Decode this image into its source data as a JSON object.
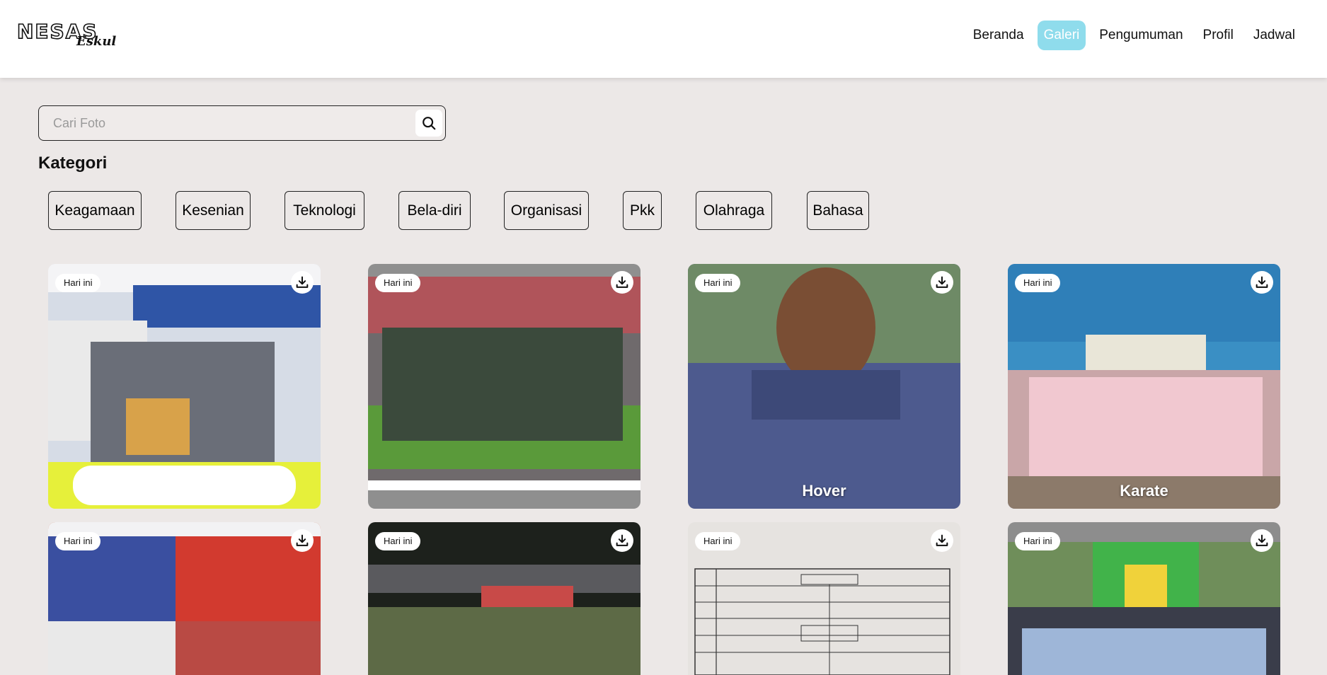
{
  "header": {
    "logo_text": "NESAS",
    "logo_subtext": "Eskul",
    "nav": [
      {
        "label": "Beranda",
        "active": false
      },
      {
        "label": "Galeri",
        "active": true
      },
      {
        "label": "Pengumuman",
        "active": false
      },
      {
        "label": "Profil",
        "active": false
      },
      {
        "label": "Jadwal",
        "active": false
      }
    ],
    "active_color": "#8fdcec"
  },
  "search": {
    "placeholder": "Cari Foto",
    "icon": "search-icon"
  },
  "categories": {
    "title": "Kategori",
    "items": [
      "Keagamaan",
      "Kesenian",
      "Teknologi",
      "Bela-diri",
      "Organisasi",
      "Pkk",
      "Olahraga",
      "Bahasa"
    ]
  },
  "gallery": {
    "download_icon": "download-icon",
    "cards": [
      {
        "badge": "Hari ini",
        "caption": ""
      },
      {
        "badge": "Hari ini",
        "caption": ""
      },
      {
        "badge": "Hari ini",
        "caption": "Hover"
      },
      {
        "badge": "Hari ini",
        "caption": "Karate"
      },
      {
        "badge": "Hari ini",
        "caption": ""
      },
      {
        "badge": "Hari ini",
        "caption": ""
      },
      {
        "badge": "Hari ini",
        "caption": ""
      },
      {
        "badge": "Hari ini",
        "caption": ""
      }
    ]
  }
}
